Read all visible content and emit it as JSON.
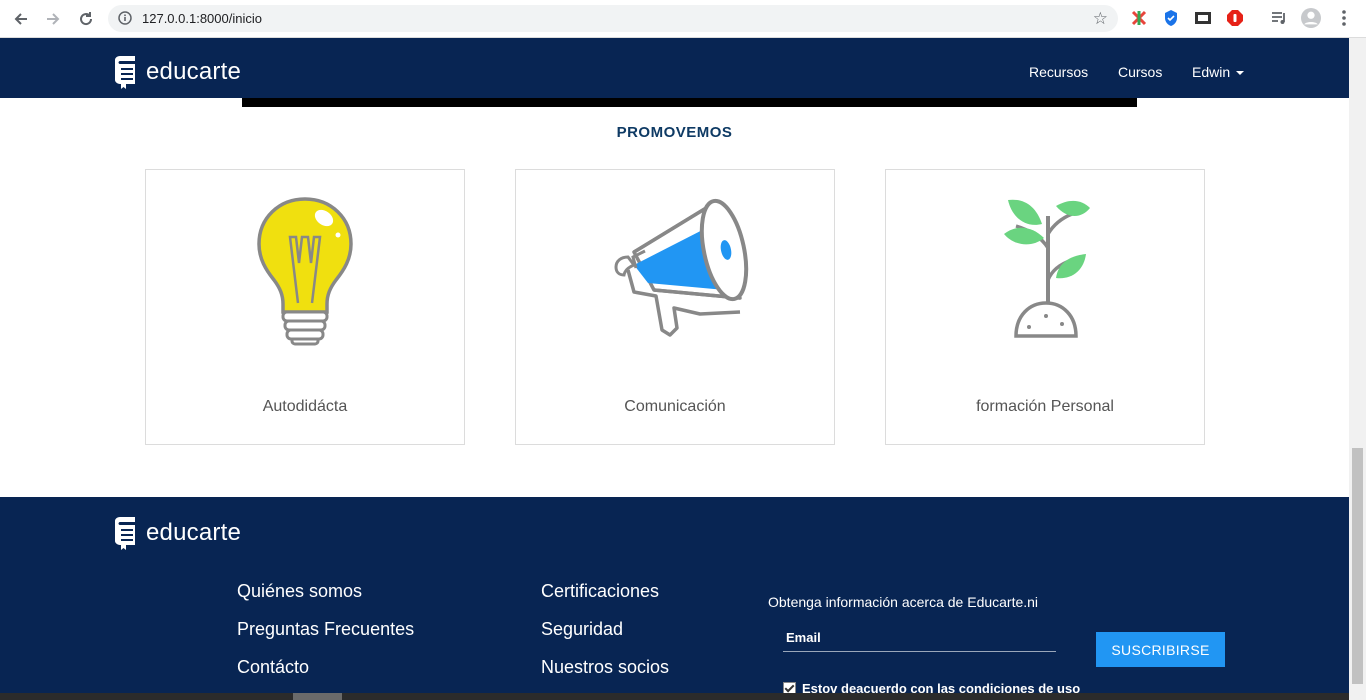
{
  "browser": {
    "url": "127.0.0.1:8000/inicio",
    "icons": [
      "back-icon",
      "forward-icon",
      "reload-icon",
      "info-icon",
      "star-icon",
      "extension-icon",
      "shield-icon",
      "extension-icon",
      "stop-icon",
      "media-icon",
      "profile-icon",
      "menu-icon"
    ]
  },
  "navbar": {
    "brand": "educarte",
    "links": [
      "Recursos",
      "Cursos",
      "Edwin"
    ]
  },
  "section": {
    "title": "PROMOVEMOS",
    "cards": [
      {
        "label": "Autodidácta",
        "icon": "lightbulb-icon"
      },
      {
        "label": "Comunicación",
        "icon": "megaphone-icon"
      },
      {
        "label": "formación Personal",
        "icon": "plant-icon"
      }
    ]
  },
  "footer": {
    "brand": "educarte",
    "col1": [
      "Quiénes somos",
      "Preguntas Frecuentes",
      "Contácto"
    ],
    "col2": [
      "Certificaciones",
      "Seguridad",
      "Nuestros socios"
    ],
    "subscribe": {
      "text": "Obtenga información acerca de Educarte.ni",
      "email_label": "Email",
      "button": "SUSCRIBIRSE",
      "terms": "Estov deacuerdo con las condiciones de uso"
    }
  },
  "colors": {
    "navy": "#082553",
    "accent": "#2196f3",
    "title": "#0e3a64"
  }
}
